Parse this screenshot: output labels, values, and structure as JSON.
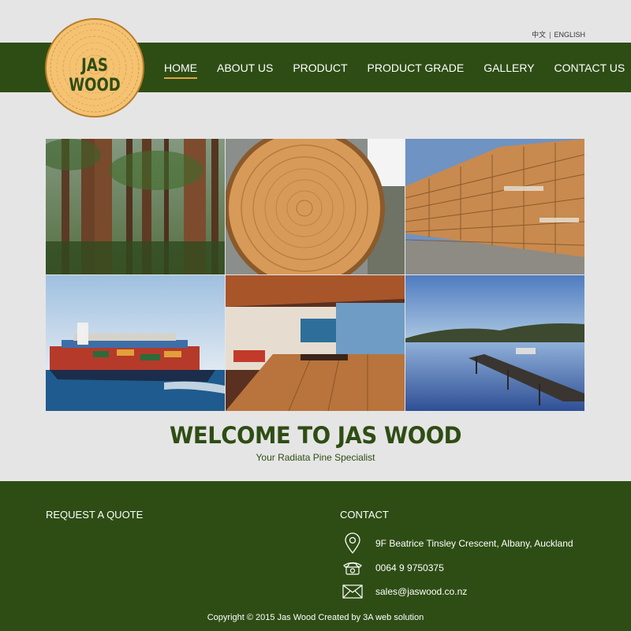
{
  "lang": {
    "chinese": "中文",
    "separator": "|",
    "english": "ENGLISH"
  },
  "logo": {
    "text": "JAS WOOD"
  },
  "nav": {
    "home": "HOME",
    "about": "ABOUT US",
    "product": "PRODUCT",
    "grade": "PRODUCT GRADE",
    "gallery": "GALLERY",
    "contact": "CONTACT US"
  },
  "gallery": [
    {
      "subject": "forest"
    },
    {
      "subject": "log cross-section"
    },
    {
      "subject": "stacked lumber"
    },
    {
      "subject": "container ship"
    },
    {
      "subject": "timber interior"
    },
    {
      "subject": "lake jetty"
    }
  ],
  "welcome": {
    "title": "WELCOME TO JAS WOOD",
    "subtitle": "Your Radiata Pine Specialist"
  },
  "footer": {
    "quote_title": "REQUEST A QUOTE",
    "contact_title": "CONTACT",
    "address": "9F Beatrice Tinsley Crescent, Albany, Auckland",
    "phone": "0064 9 9750375",
    "email": "sales@jaswood.co.nz",
    "copyright": "Copyright © 2015 Jas Wood Created by 3A web solution"
  },
  "colors": {
    "brand_green": "#2e4d14",
    "accent_orange": "#e7a43b",
    "logo_wood": "#f4c271"
  },
  "icons": [
    "map-pin-icon",
    "phone-icon",
    "envelope-icon"
  ]
}
